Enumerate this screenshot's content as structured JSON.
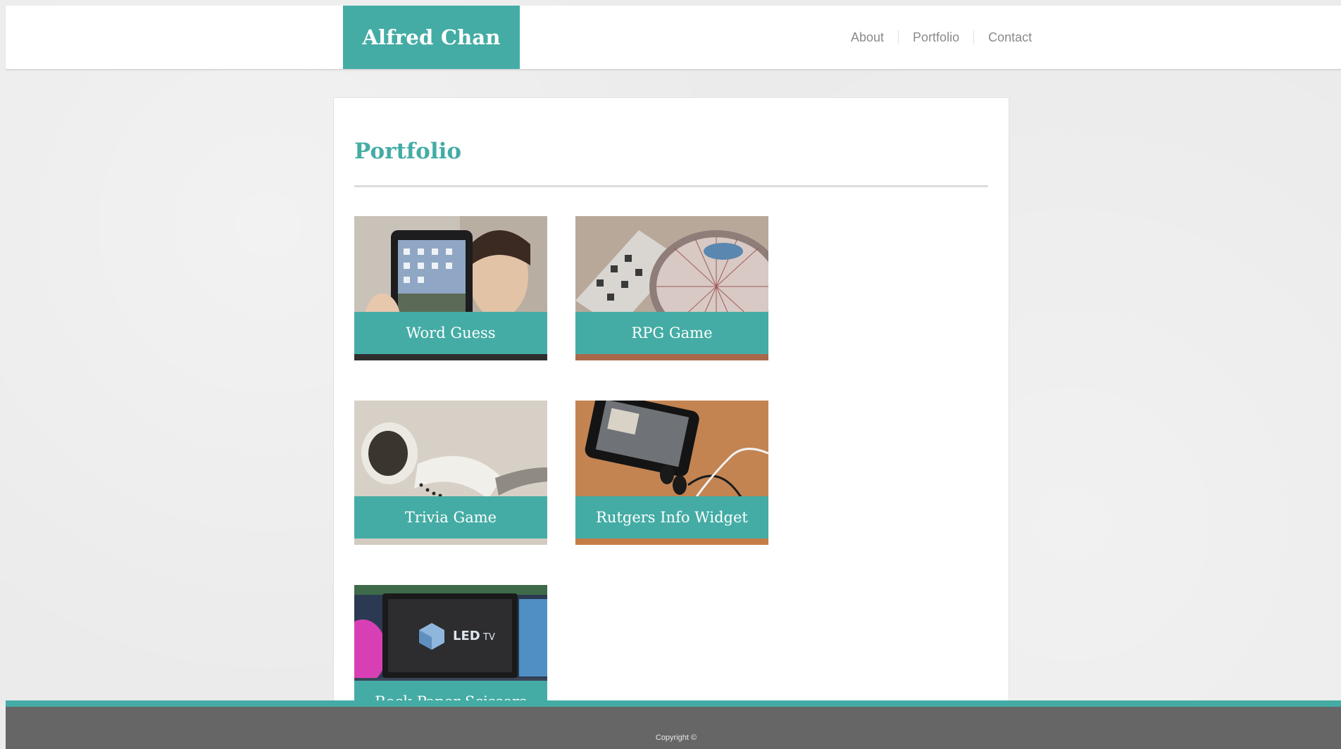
{
  "header": {
    "brand": "Alfred Chan",
    "nav": [
      {
        "label": "About"
      },
      {
        "label": "Portfolio"
      },
      {
        "label": "Contact"
      }
    ]
  },
  "main": {
    "title": "Portfolio",
    "projects": [
      {
        "label": "Word Guess",
        "image": "ipad-photo"
      },
      {
        "label": "RPG Game",
        "image": "dj-turntable-photo"
      },
      {
        "label": "Trivia Game",
        "image": "earbuds-photo"
      },
      {
        "label": "Rutgers Info Widget",
        "image": "iphone-earphones-photo"
      },
      {
        "label": "Rock Paper Scissors",
        "image": "led-tv-photo"
      }
    ]
  },
  "footer": {
    "copyright": "Copyright ©"
  },
  "colors": {
    "accent": "#44aca5",
    "footer": "#666666",
    "page_background": "#ebebeb"
  }
}
